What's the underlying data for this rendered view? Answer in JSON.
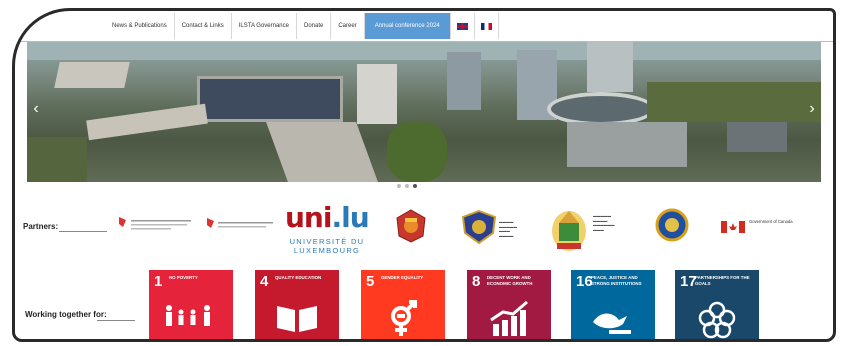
{
  "nav": {
    "items": [
      "News & Publications",
      "Contact & Links",
      "ILSTA Governance",
      "Donate",
      "Career"
    ],
    "active_item": "Annual conference 2024",
    "flags": [
      "uk-flag-icon",
      "fr-flag-icon"
    ]
  },
  "partners": {
    "label": "Partners:",
    "unilu": {
      "name": "uni",
      "dot_lu": ".lu",
      "subtitle": "UNIVERSITÉ DU LUXEMBOURG"
    },
    "canada_text": "Government of Canada"
  },
  "sdg": {
    "label": "Working together for:",
    "goals": [
      {
        "number": "1",
        "title": "No poverty",
        "color": "#e5243b",
        "icon": "family-icon"
      },
      {
        "number": "4",
        "title": "Quality education",
        "color": "#c5192d",
        "icon": "book-icon"
      },
      {
        "number": "5",
        "title": "Gender equality",
        "color": "#ff3a21",
        "icon": "gender-icon"
      },
      {
        "number": "8",
        "title": "Decent work and economic growth",
        "color": "#a21942",
        "icon": "growth-chart-icon"
      },
      {
        "number": "16",
        "title": "Peace, justice and strong institutions",
        "color": "#00689d",
        "icon": "dove-gavel-icon"
      },
      {
        "number": "17",
        "title": "Partnerships for the goals",
        "color": "#19486a",
        "icon": "rings-icon"
      }
    ]
  },
  "carousel": {
    "slides": 3,
    "current": 3
  },
  "colors": {
    "nav_active": "#5b9bd5",
    "unilu_red": "#b5121b",
    "unilu_blue": "#2a7ab8"
  }
}
